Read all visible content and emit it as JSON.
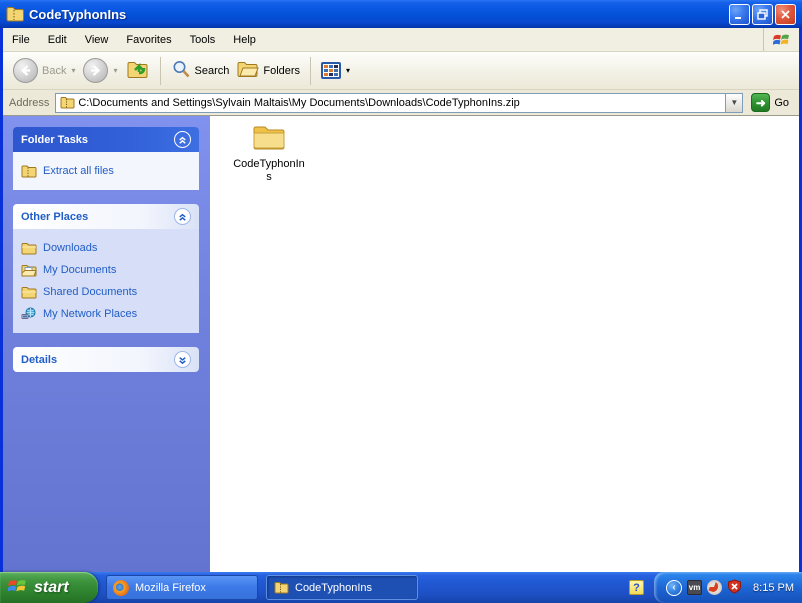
{
  "window": {
    "title": "CodeTyphonIns",
    "controls": {
      "minimize": "minimize",
      "restore": "restore",
      "close": "close"
    }
  },
  "menu": {
    "items": [
      "File",
      "Edit",
      "View",
      "Favorites",
      "Tools",
      "Help"
    ]
  },
  "toolbar": {
    "back_label": "Back",
    "search_label": "Search",
    "folders_label": "Folders"
  },
  "address_bar": {
    "label": "Address",
    "value": "C:\\Documents and Settings\\Sylvain Maltais\\My Documents\\Downloads\\CodeTyphonIns.zip",
    "go_label": "Go"
  },
  "sidebar": {
    "folder_tasks": {
      "title": "Folder Tasks",
      "items": [
        {
          "label": "Extract all files",
          "icon": "zip-folder-icon"
        }
      ]
    },
    "other_places": {
      "title": "Other Places",
      "items": [
        {
          "label": "Downloads",
          "icon": "folder-icon"
        },
        {
          "label": "My Documents",
          "icon": "my-documents-icon"
        },
        {
          "label": "Shared Documents",
          "icon": "shared-documents-icon"
        },
        {
          "label": "My Network Places",
          "icon": "network-places-icon"
        }
      ]
    },
    "details": {
      "title": "Details"
    }
  },
  "content": {
    "items": [
      {
        "label": "CodeTyphonIns",
        "icon": "folder-icon"
      }
    ]
  },
  "taskbar": {
    "start_label": "start",
    "tasks": [
      {
        "label": "Mozilla Firefox",
        "icon": "firefox-icon",
        "active": false
      },
      {
        "label": "CodeTyphonIns",
        "icon": "zip-folder-icon",
        "active": true
      }
    ],
    "tray": {
      "icons": [
        "help-icon",
        "collapse-chevron-icon",
        "vmware-icon",
        "app-swirl-icon",
        "security-alert-icon"
      ],
      "vm_label": "vm",
      "help_glyph": "?",
      "clock": "8:15 PM"
    }
  },
  "colors": {
    "title_blue": "#0351D5",
    "taskbar_blue": "#2159D4",
    "start_green": "#2E832E",
    "sidebar_blue": "#6F81DC",
    "link_blue": "#215DC6",
    "pane_lavender": "#D6DFF7",
    "chrome_beige": "#ECE9D8",
    "close_red": "#C13D1F"
  }
}
